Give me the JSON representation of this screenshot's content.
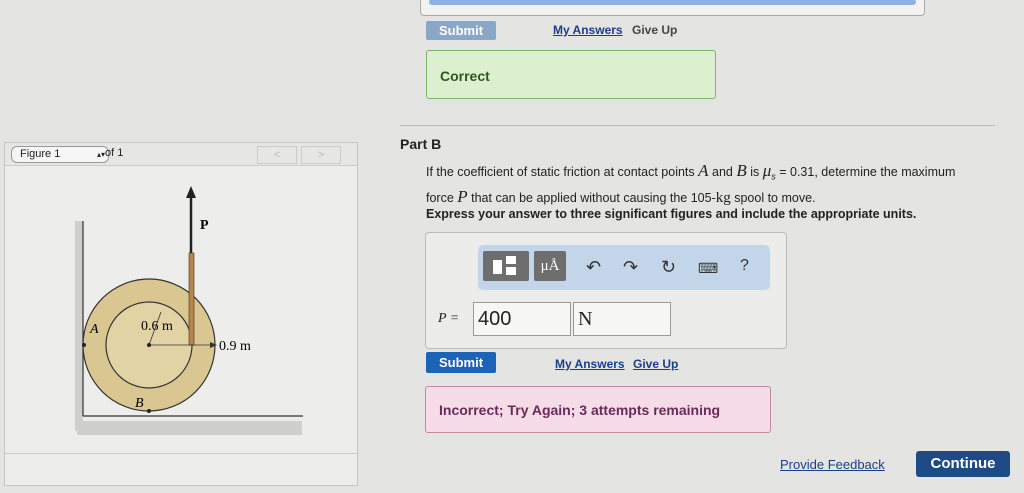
{
  "part_a": {
    "submit_label": "Submit",
    "my_answers": "My Answers",
    "give_up": "Give Up",
    "feedback": "Correct"
  },
  "figure": {
    "selector": "Figure 1",
    "of": "of 1",
    "labels": {
      "p": "P",
      "a": "A",
      "b": "B",
      "inner": "0.6 m",
      "outer": "0.9 m"
    }
  },
  "part_b": {
    "title": "Part B",
    "q1": "If the coefficient of static friction at contact points ",
    "A": "A",
    "and": " and ",
    "B": "B",
    "is": " is ",
    "mu": "μ",
    "mu_sub": "s",
    "q2": " = 0.31, determine the maximum",
    "q3": "force ",
    "P": "P",
    "q4": " that can be applied without causing the 105-",
    "kg": "kg",
    "q5": " spool to move.",
    "instruction": "Express your answer to three significant figures and include the appropriate units.",
    "toolbar": {
      "units": "μÅ",
      "help": "?"
    },
    "answer_label": "P =",
    "answer_value": "400",
    "answer_unit": "N",
    "submit_label": "Submit",
    "my_answers": "My Answers",
    "give_up": "Give Up",
    "feedback": "Incorrect; Try Again; 3 attempts remaining"
  },
  "footer": {
    "provide_feedback": "Provide Feedback",
    "continue": "Continue"
  }
}
